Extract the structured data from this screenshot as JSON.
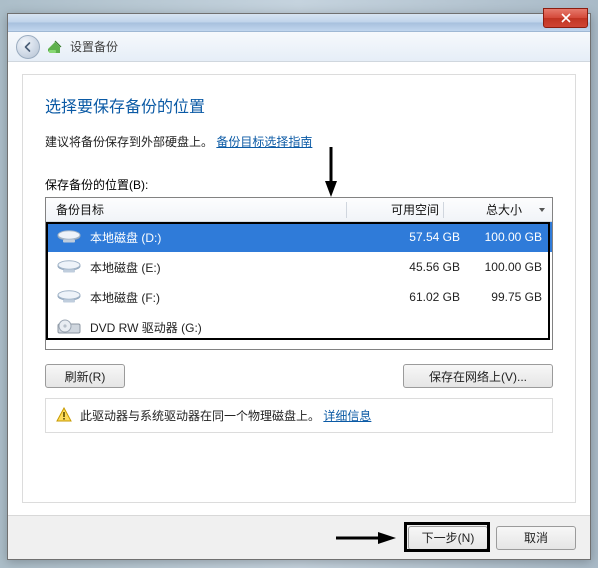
{
  "titlebar": {
    "nav_title": "设置备份"
  },
  "heading": "选择要保存备份的位置",
  "intro_text": "建议将备份保存到外部硬盘上。",
  "intro_link": "备份目标选择指南",
  "list_label": "保存备份的位置(B):",
  "columns": {
    "target": "备份目标",
    "free": "可用空间",
    "total": "总大小"
  },
  "drives": [
    {
      "name": "本地磁盘 (D:)",
      "free": "57.54 GB",
      "total": "100.00 GB",
      "type": "hdd",
      "selected": true
    },
    {
      "name": "本地磁盘 (E:)",
      "free": "45.56 GB",
      "total": "100.00 GB",
      "type": "hdd",
      "selected": false
    },
    {
      "name": "本地磁盘 (F:)",
      "free": "61.02 GB",
      "total": "99.75 GB",
      "type": "hdd",
      "selected": false
    },
    {
      "name": "DVD RW 驱动器 (G:)",
      "free": "",
      "total": "",
      "type": "dvd",
      "selected": false
    }
  ],
  "buttons": {
    "refresh": "刷新(R)",
    "save_network": "保存在网络上(V)...",
    "next": "下一步(N)",
    "cancel": "取消"
  },
  "hint_text": "此驱动器与系统驱动器在同一个物理磁盘上。",
  "hint_link": "详细信息"
}
